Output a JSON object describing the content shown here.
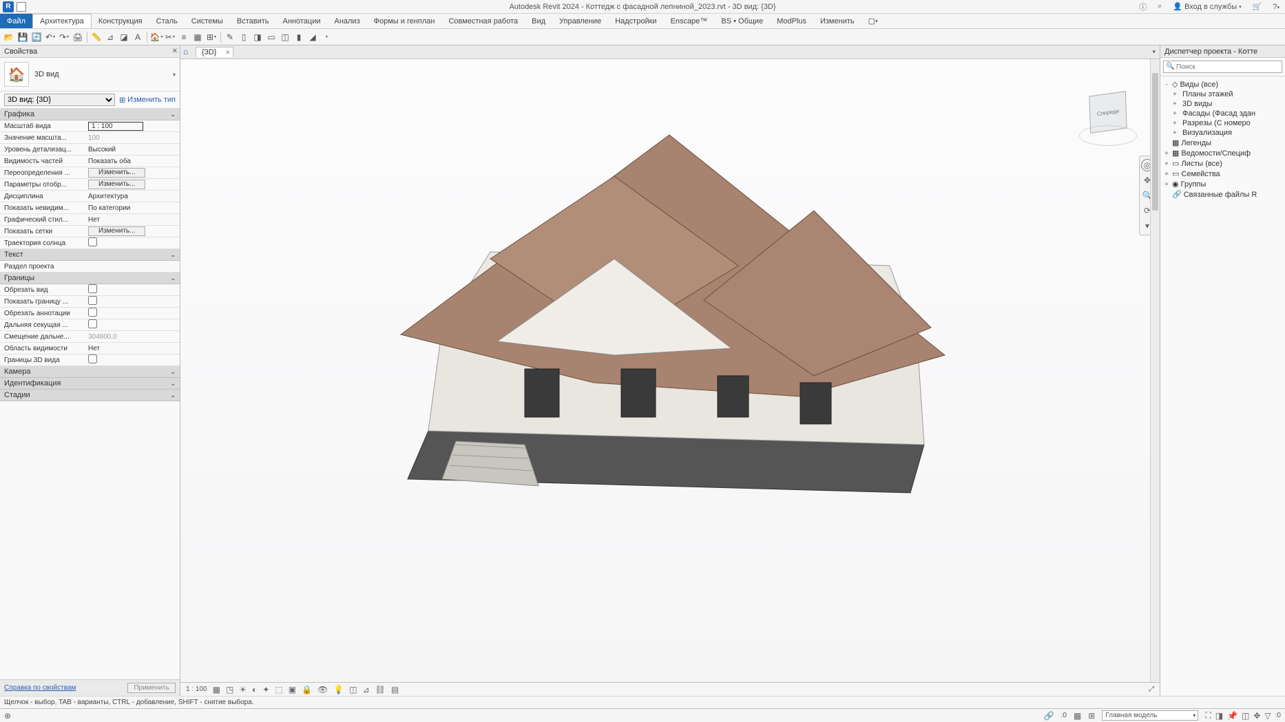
{
  "title": "Autodesk Revit 2024 - Коттедж с фасадной лепниной_2023.rvt - 3D вид: {3D}",
  "top_right": {
    "search_icon": "⌕",
    "login": "Вход в службы",
    "cart": "🛒",
    "help": "?"
  },
  "ribbon": {
    "file": "Файл",
    "tabs": [
      "Архитектура",
      "Конструкция",
      "Сталь",
      "Системы",
      "Вставить",
      "Аннотации",
      "Анализ",
      "Формы и генплан",
      "Совместная работа",
      "Вид",
      "Управление",
      "Надстройки",
      "Enscape™",
      "BS • Общие",
      "ModPlus",
      "Изменить"
    ],
    "active": 0
  },
  "properties": {
    "title": "Свойства",
    "type_label": "3D вид",
    "instance": "3D вид: {3D}",
    "edit_type": "Изменить тип",
    "groups": {
      "graphics": {
        "title": "Графика",
        "rows": [
          {
            "k": "Масштаб вида",
            "v": "1 : 100",
            "boxed": true
          },
          {
            "k": "Значение масшта...",
            "v": "100",
            "dim": true
          },
          {
            "k": "Уровень детализац...",
            "v": "Высокий"
          },
          {
            "k": "Видимость частей",
            "v": "Показать оба"
          },
          {
            "k": "Переопределения ...",
            "v": "Изменить...",
            "btn": true
          },
          {
            "k": "Параметры отобр...",
            "v": "Изменить...",
            "btn": true
          },
          {
            "k": "Дисциплина",
            "v": "Архитектура"
          },
          {
            "k": "Показать невидим...",
            "v": "По категории"
          },
          {
            "k": "Графический стил...",
            "v": "Нет"
          },
          {
            "k": "Показать сетки",
            "v": "Изменить...",
            "btn": true
          },
          {
            "k": "Траектория солнца",
            "v": "",
            "chk": true
          }
        ]
      },
      "text": {
        "title": "Текст",
        "rows": [
          {
            "k": "Раздел проекта",
            "v": ""
          }
        ]
      },
      "extents": {
        "title": "Границы",
        "rows": [
          {
            "k": "Обрезать вид",
            "v": "",
            "chk": true
          },
          {
            "k": "Показать границу ...",
            "v": "",
            "chk": true
          },
          {
            "k": "Обрезать аннотации",
            "v": "",
            "chk": true
          },
          {
            "k": "Дальняя секущая ...",
            "v": "",
            "chk": true
          },
          {
            "k": "Смещение дальне...",
            "v": "304800,0",
            "dim": true
          },
          {
            "k": "Область видимости",
            "v": "Нет"
          },
          {
            "k": "Границы 3D вида",
            "v": "",
            "chk": true
          }
        ]
      },
      "camera": {
        "title": "Камера"
      },
      "identity": {
        "title": "Идентификация"
      },
      "phasing": {
        "title": "Стадии"
      }
    },
    "help_link": "Справка по свойствам",
    "apply": "Применить"
  },
  "doc_tab": "{3D}",
  "viewcube_face": "Спереди",
  "view_controls": {
    "scale": "1 : 100"
  },
  "browser": {
    "title": "Диспетчер проекта - Котте",
    "search_placeholder": "Поиск",
    "items": [
      {
        "lvl": 1,
        "tg": "-",
        "ico": "◇",
        "label": "Виды (все)"
      },
      {
        "lvl": 2,
        "tg": "+",
        "ico": "",
        "label": "Планы этажей"
      },
      {
        "lvl": 2,
        "tg": "+",
        "ico": "",
        "label": "3D виды"
      },
      {
        "lvl": 2,
        "tg": "+",
        "ico": "",
        "label": "Фасады (Фасад здан"
      },
      {
        "lvl": 2,
        "tg": "+",
        "ico": "",
        "label": "Разрезы (С номеро"
      },
      {
        "lvl": 2,
        "tg": "+",
        "ico": "",
        "label": "Визуализация"
      },
      {
        "lvl": 1,
        "tg": "",
        "ico": "▦",
        "label": "Легенды"
      },
      {
        "lvl": 1,
        "tg": "+",
        "ico": "▦",
        "label": "Ведомости/Специф"
      },
      {
        "lvl": 1,
        "tg": "+",
        "ico": "▭",
        "label": "Листы (все)"
      },
      {
        "lvl": 1,
        "tg": "+",
        "ico": "▭",
        "label": "Семейства"
      },
      {
        "lvl": 1,
        "tg": "+",
        "ico": "◉",
        "label": "Группы"
      },
      {
        "lvl": 1,
        "tg": "",
        "ico": "🔗",
        "label": "Связанные файлы R"
      }
    ]
  },
  "status": {
    "hint": "Щелчок - выбор, TAB - варианты, CTRL - добавление, SHIFT - снятие выбора.",
    "main_model": "Главная модель",
    "zero": ":0"
  }
}
